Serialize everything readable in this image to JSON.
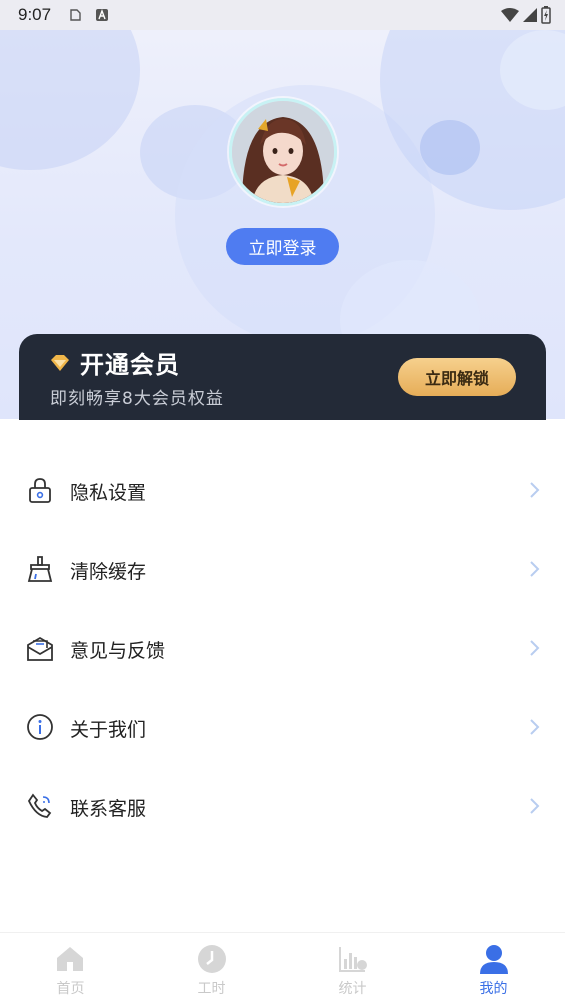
{
  "status_bar": {
    "time": "9:07",
    "icons": [
      "file-icon",
      "a-badge-icon",
      "wifi-icon",
      "signal-icon",
      "battery-icon"
    ]
  },
  "profile": {
    "avatar": "avatar-girl-illustration",
    "login_label": "立即登录"
  },
  "vip": {
    "title": "开通会员",
    "subtitle": "即刻畅享8大会员权益",
    "button_label": "立即解锁",
    "icon": "diamond-icon"
  },
  "menu": {
    "items": [
      {
        "label": "隐私设置",
        "icon": "lock-icon"
      },
      {
        "label": "清除缓存",
        "icon": "broom-icon"
      },
      {
        "label": "意见与反馈",
        "icon": "mail-icon"
      },
      {
        "label": "关于我们",
        "icon": "info-icon"
      },
      {
        "label": "联系客服",
        "icon": "phone-service-icon"
      }
    ]
  },
  "tabs": [
    {
      "label": "首页",
      "icon": "home-icon",
      "active": false
    },
    {
      "label": "工时",
      "icon": "clock-icon",
      "active": false
    },
    {
      "label": "统计",
      "icon": "chart-icon",
      "active": false
    },
    {
      "label": "我的",
      "icon": "user-icon",
      "active": true
    }
  ],
  "colors": {
    "accent": "#4f7cf1",
    "vip_card": "#232a37",
    "vip_button": "#e6ad58",
    "tab_active": "#3a6fe6",
    "tab_inactive": "#c9c9c9"
  }
}
